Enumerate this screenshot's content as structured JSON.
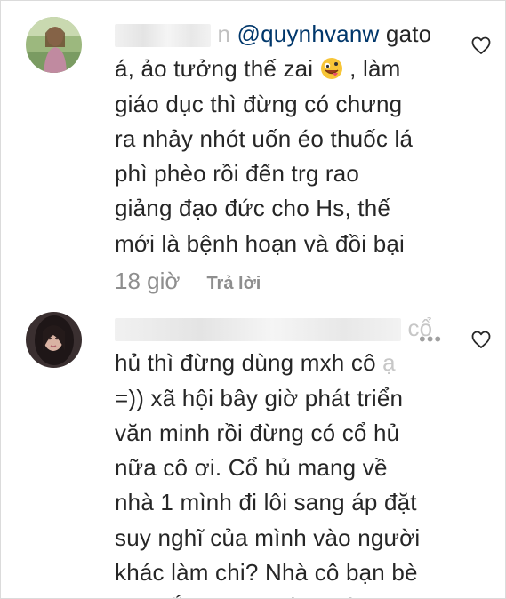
{
  "comments": [
    {
      "mention": "@quynhvanw",
      "first_line_suffix": " gato",
      "lines": [
        "á, ảo tưởng thế zai",
        "giáo dục thì đừng có chưng",
        "ra nhảy nhót uốn éo thuốc lá",
        "phì phèo rồi đến trg rao",
        "giảng đạo đức cho Hs, thế",
        "mới là bệnh hoạn và đồi bại"
      ],
      "after_emoji": " , làm",
      "emoji_name": "zany-face-emoji",
      "time": "18 giờ",
      "reply_label": "Trả lời"
    },
    {
      "faded_tail": "cổ",
      "lines": [
        "hủ thì đừng dùng mxh cô",
        "=)) xã hội bây giờ phát triển",
        "văn minh rồi đừng có cổ hủ",
        "nữa cô ơi. Cổ hủ mang về",
        "nhà 1 mình đi lôi sang áp đặt",
        "suy nghĩ của mình vào người",
        "khác làm chi? Nhà cô bạn bè",
        "cô chắc không có ai hút"
      ],
      "faded_suffix": " ạ",
      "more_label": "•••"
    }
  ],
  "icons": {
    "heart": "heart-outline-icon"
  },
  "colors": {
    "text": "#262626",
    "muted": "#8e8e8e",
    "mention": "#00376b",
    "border": "#dbdbdb"
  }
}
